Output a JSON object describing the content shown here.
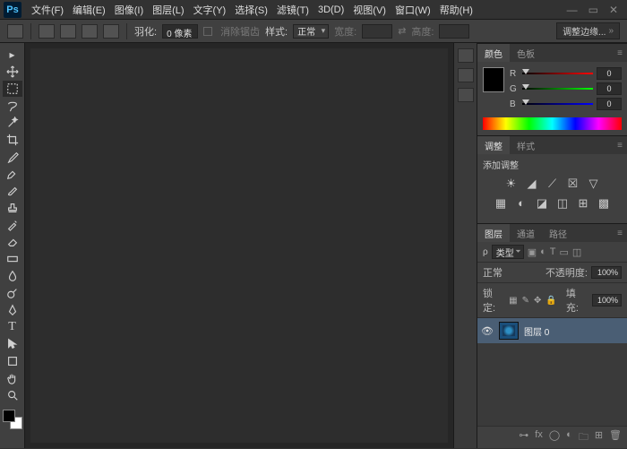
{
  "app": {
    "logo_text": "Ps"
  },
  "menu": [
    "文件(F)",
    "编辑(E)",
    "图像(I)",
    "图层(L)",
    "文字(Y)",
    "选择(S)",
    "滤镜(T)",
    "3D(D)",
    "视图(V)",
    "窗口(W)",
    "帮助(H)"
  ],
  "optbar": {
    "feather_label": "羽化:",
    "feather_value": "0 像素",
    "antialias_label": "消除锯齿",
    "style_label": "样式:",
    "style_value": "正常",
    "width_label": "宽度:",
    "height_label": "高度:",
    "adjust_edge": "调整边缘..."
  },
  "color_panel": {
    "tab_color": "颜色",
    "tab_swatches": "色板",
    "channels": [
      {
        "label": "R",
        "value": "0"
      },
      {
        "label": "G",
        "value": "0"
      },
      {
        "label": "B",
        "value": "0"
      }
    ]
  },
  "adjust_panel": {
    "tab_adjust": "调整",
    "tab_styles": "样式",
    "title": "添加调整"
  },
  "layers_panel": {
    "tab_layers": "图层",
    "tab_channels": "通道",
    "tab_paths": "路径",
    "type_label": "类型",
    "blend_mode": "正常",
    "opacity_label": "不透明度:",
    "opacity_value": "100%",
    "lock_label": "锁定:",
    "fill_label": "填充:",
    "fill_value": "100%",
    "layer0_name": "图层 0"
  }
}
